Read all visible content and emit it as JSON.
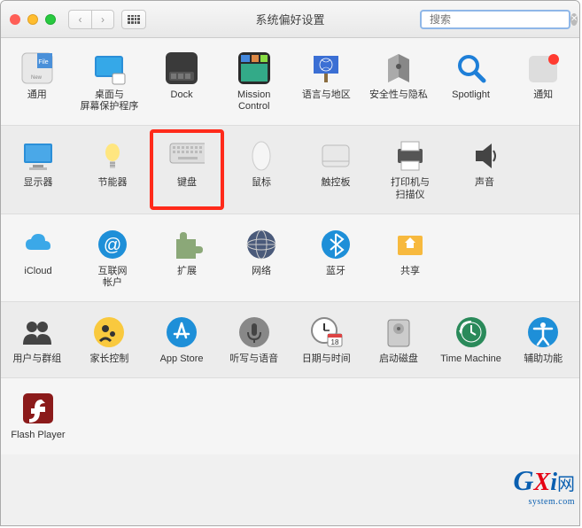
{
  "window": {
    "title": "系统偏好设置"
  },
  "search": {
    "placeholder": "搜索"
  },
  "rows": [
    [
      {
        "id": "general",
        "label": "通用"
      },
      {
        "id": "desktop",
        "label": "桌面与\n屏幕保护程序"
      },
      {
        "id": "dock",
        "label": "Dock"
      },
      {
        "id": "mission",
        "label": "Mission\nControl"
      },
      {
        "id": "language",
        "label": "语言与地区"
      },
      {
        "id": "security",
        "label": "安全性与隐私"
      },
      {
        "id": "spotlight",
        "label": "Spotlight"
      },
      {
        "id": "notifications",
        "label": "通知"
      }
    ],
    [
      {
        "id": "displays",
        "label": "显示器"
      },
      {
        "id": "energy",
        "label": "节能器"
      },
      {
        "id": "keyboard",
        "label": "键盘",
        "highlight": true
      },
      {
        "id": "mouse",
        "label": "鼠标"
      },
      {
        "id": "trackpad",
        "label": "触控板"
      },
      {
        "id": "printers",
        "label": "打印机与\n扫描仪"
      },
      {
        "id": "sound",
        "label": "声音"
      }
    ],
    [
      {
        "id": "icloud",
        "label": "iCloud"
      },
      {
        "id": "internet",
        "label": "互联网\n帐户"
      },
      {
        "id": "extensions",
        "label": "扩展"
      },
      {
        "id": "network",
        "label": "网络"
      },
      {
        "id": "bluetooth",
        "label": "蓝牙"
      },
      {
        "id": "sharing",
        "label": "共享"
      }
    ],
    [
      {
        "id": "users",
        "label": "用户与群组"
      },
      {
        "id": "parental",
        "label": "家长控制"
      },
      {
        "id": "appstore",
        "label": "App Store"
      },
      {
        "id": "dictation",
        "label": "听写与语音"
      },
      {
        "id": "datetime",
        "label": "日期与时间"
      },
      {
        "id": "startup",
        "label": "启动磁盘"
      },
      {
        "id": "timemachine",
        "label": "Time Machine"
      },
      {
        "id": "accessibility",
        "label": "辅助功能"
      }
    ],
    [
      {
        "id": "flash",
        "label": "Flash Player"
      }
    ]
  ],
  "watermark": {
    "g": "G",
    "x": "X",
    "i": "i",
    "sub": "system.com",
    "net": "网"
  }
}
